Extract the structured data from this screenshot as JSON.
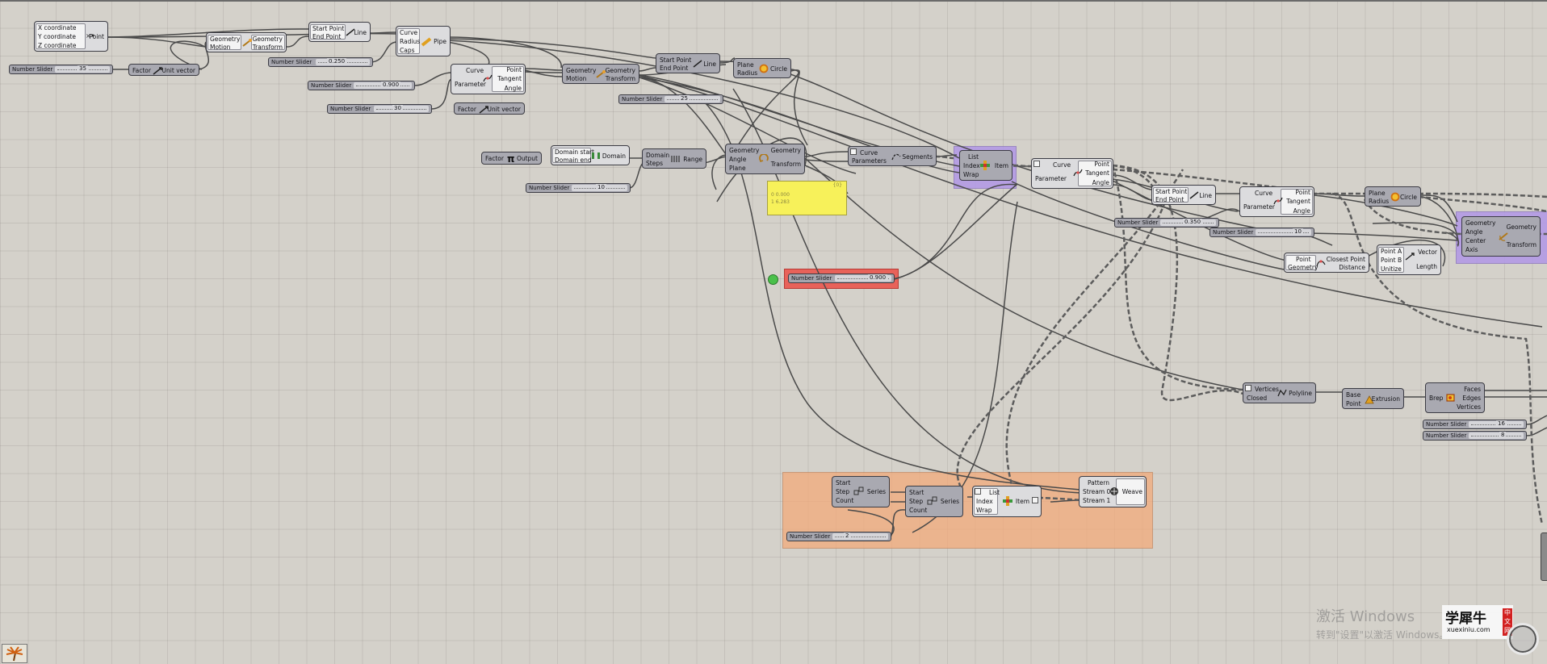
{
  "colors": {
    "canvas": "#d4d1ca",
    "node": "#a9a9b1",
    "wire": "#4a4a4a",
    "group_orange": "#f3b48a",
    "group_purple": "#b6a4e6",
    "selected_red": "#e8625a",
    "panel_yellow": "#f7f15a",
    "toggle_green": "#4ac04a"
  },
  "nodes": {
    "construct_point": {
      "inputs": [
        "X coordinate",
        "Y coordinate",
        "Z coordinate"
      ],
      "name": "Point"
    },
    "move_1": {
      "inputs": [
        "Geometry",
        "Motion"
      ],
      "outputs": [
        "Geometry",
        "Transform"
      ]
    },
    "line_1": {
      "inputs": [
        "Start Point",
        "End Point"
      ],
      "name": "Line"
    },
    "pipe": {
      "inputs": [
        "Curve",
        "Radius",
        "Caps"
      ],
      "name": "Pipe"
    },
    "unit_vector_1": {
      "inputs": [
        "Factor"
      ],
      "name": "Unit vector"
    },
    "eval_curve_1": {
      "inputs": [
        "Curve",
        "Parameter"
      ],
      "outputs": [
        "Point",
        "Tangent",
        "Angle"
      ]
    },
    "move_2": {
      "inputs": [
        "Geometry",
        "Motion"
      ],
      "outputs": [
        "Geometry",
        "Transform"
      ]
    },
    "line_2": {
      "inputs": [
        "Start Point",
        "End Point"
      ],
      "name": "Line"
    },
    "circle_1": {
      "inputs": [
        "Plane",
        "Radius"
      ],
      "name": "Circle"
    },
    "unit_vector_2": {
      "inputs": [
        "Factor"
      ],
      "name": "Unit vector"
    },
    "pi": {
      "inputs": [
        "Factor"
      ],
      "name": "Output"
    },
    "domain": {
      "inputs": [
        "Domain start",
        "Domain end"
      ],
      "name": "Domain"
    },
    "range": {
      "inputs": [
        "Domain",
        "Steps"
      ],
      "name": "Range"
    },
    "rotate_1": {
      "inputs": [
        "Geometry",
        "Angle",
        "Plane"
      ],
      "outputs": [
        "Geometry",
        "Transform"
      ]
    },
    "shatter": {
      "inputs": [
        "Curve",
        "Parameters"
      ],
      "name": "Segments"
    },
    "list_item_1": {
      "inputs": [
        "List",
        "Index",
        "Wrap"
      ],
      "name": "Item"
    },
    "eval_curve_2": {
      "inputs": [
        "Curve",
        "Parameter"
      ],
      "outputs": [
        "Point",
        "Tangent",
        "Angle"
      ]
    },
    "line_3": {
      "inputs": [
        "Start Point",
        "End Point"
      ],
      "name": "Line"
    },
    "eval_curve_3": {
      "inputs": [
        "Curve",
        "Parameter"
      ],
      "outputs": [
        "Point",
        "Tangent",
        "Angle"
      ]
    },
    "circle_2": {
      "inputs": [
        "Plane",
        "Radius"
      ],
      "name": "Circle"
    },
    "rotate_axis": {
      "inputs": [
        "Geometry",
        "Angle",
        "Center",
        "Axis"
      ],
      "outputs": [
        "Geometry",
        "Transform"
      ]
    },
    "closest_point": {
      "inputs": [
        "Point",
        "Geometry"
      ],
      "outputs": [
        "Closest Point",
        "Distance"
      ]
    },
    "vector_2pt": {
      "inputs": [
        "Point A",
        "Point B",
        "Unitize"
      ],
      "outputs": [
        "Vector",
        "Length"
      ]
    },
    "polyline": {
      "inputs": [
        "Vertices",
        "Closed"
      ],
      "name": "Polyline"
    },
    "extrusion": {
      "inputs": [
        "Base",
        "Point"
      ],
      "name": "Extrusion"
    },
    "deconstruct_brep": {
      "inputs": [
        "Brep"
      ],
      "outputs": [
        "Faces",
        "Edges",
        "Vertices"
      ]
    },
    "series_1": {
      "inputs": [
        "Start",
        "Step",
        "Count"
      ],
      "name": "Series"
    },
    "series_2": {
      "inputs": [
        "Start",
        "Step",
        "Count"
      ],
      "name": "Series"
    },
    "list_item_2": {
      "inputs": [
        "List",
        "Index",
        "Wrap"
      ],
      "name": "Item"
    },
    "weave": {
      "inputs": [
        "Pattern",
        "Stream 0",
        "Stream 1"
      ],
      "name": "Weave"
    }
  },
  "sliders": [
    {
      "label": "Number Slider",
      "value": "35"
    },
    {
      "label": "Number Slider",
      "value": "0.250"
    },
    {
      "label": "Number Slider",
      "value": "0.900"
    },
    {
      "label": "Number Slider",
      "value": "30"
    },
    {
      "label": "Number Slider",
      "value": "25"
    },
    {
      "label": "Number Slider",
      "value": "10"
    },
    {
      "label": "Number Slider",
      "value": "0.900"
    },
    {
      "label": "Number Slider",
      "value": "0.350"
    },
    {
      "label": "Number Slider",
      "value": "10"
    },
    {
      "label": "Number Slider",
      "value": "16"
    },
    {
      "label": "Number Slider",
      "value": "8"
    },
    {
      "label": "Number Slider",
      "value": "2"
    }
  ],
  "panel": {
    "header": "{0}",
    "lines": [
      "0 0.000",
      "1 6.283"
    ]
  },
  "watermark": {
    "line1": "激活 Windows",
    "line2": "转到\"设置\"以激活 Windows。"
  },
  "logo": {
    "name": "学犀牛",
    "sub": "xuexiniu.com",
    "badge": "中文网"
  }
}
